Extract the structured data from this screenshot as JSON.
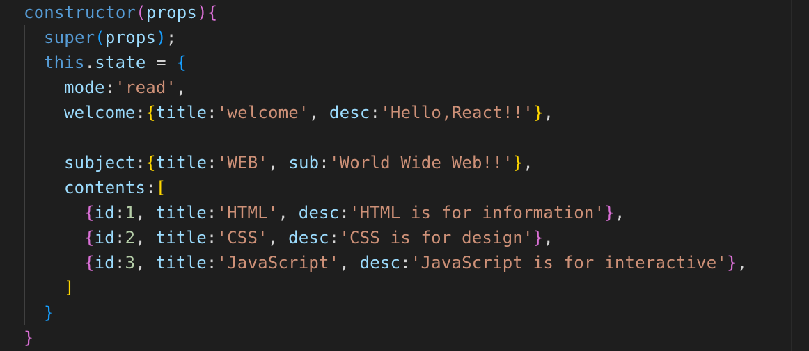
{
  "editor": {
    "colors": {
      "background": "#1e1e1e",
      "function": "#dcdcaa",
      "keyword": "#569cd6",
      "property": "#9cdcfe",
      "string": "#ce9178",
      "number": "#b5cea8",
      "punctuation": "#d4d4d4",
      "bracket_level_1": "#ffd700",
      "bracket_level_2": "#da70d6",
      "bracket_level_3": "#179fff"
    },
    "lines": [
      {
        "indent": 0,
        "tokens": [
          {
            "t": "constructor",
            "c": "key"
          },
          {
            "t": "(",
            "c": "b2"
          },
          {
            "t": "props",
            "c": "var"
          },
          {
            "t": ")",
            "c": "b2"
          },
          {
            "t": "{",
            "c": "b2"
          }
        ]
      },
      {
        "indent": 1,
        "tokens": [
          {
            "t": "super",
            "c": "key"
          },
          {
            "t": "(",
            "c": "b3"
          },
          {
            "t": "props",
            "c": "var"
          },
          {
            "t": ")",
            "c": "b3"
          },
          {
            "t": ";",
            "c": "punc"
          }
        ]
      },
      {
        "indent": 1,
        "tokens": [
          {
            "t": "this",
            "c": "key"
          },
          {
            "t": ".",
            "c": "punc"
          },
          {
            "t": "state",
            "c": "var"
          },
          {
            "t": " = ",
            "c": "punc"
          },
          {
            "t": "{",
            "c": "b3"
          }
        ]
      },
      {
        "indent": 2,
        "tokens": [
          {
            "t": "mode",
            "c": "var"
          },
          {
            "t": ":",
            "c": "punc"
          },
          {
            "t": "'read'",
            "c": "str"
          },
          {
            "t": ",",
            "c": "punc"
          }
        ]
      },
      {
        "indent": 2,
        "tokens": [
          {
            "t": "welcome",
            "c": "var"
          },
          {
            "t": ":",
            "c": "punc"
          },
          {
            "t": "{",
            "c": "b1"
          },
          {
            "t": "title",
            "c": "var"
          },
          {
            "t": ":",
            "c": "punc"
          },
          {
            "t": "'welcome'",
            "c": "str"
          },
          {
            "t": ", ",
            "c": "punc"
          },
          {
            "t": "desc",
            "c": "var"
          },
          {
            "t": ":",
            "c": "punc"
          },
          {
            "t": "'Hello,React!!'",
            "c": "str"
          },
          {
            "t": "}",
            "c": "b1"
          },
          {
            "t": ",",
            "c": "punc"
          }
        ]
      },
      {
        "indent": 2,
        "tokens": []
      },
      {
        "indent": 2,
        "tokens": [
          {
            "t": "subject",
            "c": "var"
          },
          {
            "t": ":",
            "c": "punc"
          },
          {
            "t": "{",
            "c": "b1"
          },
          {
            "t": "title",
            "c": "var"
          },
          {
            "t": ":",
            "c": "punc"
          },
          {
            "t": "'WEB'",
            "c": "str"
          },
          {
            "t": ", ",
            "c": "punc"
          },
          {
            "t": "sub",
            "c": "var"
          },
          {
            "t": ":",
            "c": "punc"
          },
          {
            "t": "'World Wide Web!!'",
            "c": "str"
          },
          {
            "t": "}",
            "c": "b1"
          },
          {
            "t": ",",
            "c": "punc"
          }
        ]
      },
      {
        "indent": 2,
        "tokens": [
          {
            "t": "contents",
            "c": "var"
          },
          {
            "t": ":",
            "c": "punc"
          },
          {
            "t": "[",
            "c": "b1"
          }
        ]
      },
      {
        "indent": 3,
        "tokens": [
          {
            "t": "{",
            "c": "b2"
          },
          {
            "t": "id",
            "c": "var"
          },
          {
            "t": ":",
            "c": "punc"
          },
          {
            "t": "1",
            "c": "num"
          },
          {
            "t": ", ",
            "c": "punc"
          },
          {
            "t": "title",
            "c": "var"
          },
          {
            "t": ":",
            "c": "punc"
          },
          {
            "t": "'HTML'",
            "c": "str"
          },
          {
            "t": ", ",
            "c": "punc"
          },
          {
            "t": "desc",
            "c": "var"
          },
          {
            "t": ":",
            "c": "punc"
          },
          {
            "t": "'HTML is for information'",
            "c": "str"
          },
          {
            "t": "}",
            "c": "b2"
          },
          {
            "t": ",",
            "c": "punc"
          }
        ]
      },
      {
        "indent": 3,
        "tokens": [
          {
            "t": "{",
            "c": "b2"
          },
          {
            "t": "id",
            "c": "var"
          },
          {
            "t": ":",
            "c": "punc"
          },
          {
            "t": "2",
            "c": "num"
          },
          {
            "t": ", ",
            "c": "punc"
          },
          {
            "t": "title",
            "c": "var"
          },
          {
            "t": ":",
            "c": "punc"
          },
          {
            "t": "'CSS'",
            "c": "str"
          },
          {
            "t": ", ",
            "c": "punc"
          },
          {
            "t": "desc",
            "c": "var"
          },
          {
            "t": ":",
            "c": "punc"
          },
          {
            "t": "'CSS is for design'",
            "c": "str"
          },
          {
            "t": "}",
            "c": "b2"
          },
          {
            "t": ",",
            "c": "punc"
          }
        ]
      },
      {
        "indent": 3,
        "tokens": [
          {
            "t": "{",
            "c": "b2"
          },
          {
            "t": "id",
            "c": "var"
          },
          {
            "t": ":",
            "c": "punc"
          },
          {
            "t": "3",
            "c": "num"
          },
          {
            "t": ", ",
            "c": "punc"
          },
          {
            "t": "title",
            "c": "var"
          },
          {
            "t": ":",
            "c": "punc"
          },
          {
            "t": "'JavaScript'",
            "c": "str"
          },
          {
            "t": ", ",
            "c": "punc"
          },
          {
            "t": "desc",
            "c": "var"
          },
          {
            "t": ":",
            "c": "punc"
          },
          {
            "t": "'JavaScript is for interactive'",
            "c": "str"
          },
          {
            "t": "}",
            "c": "b2"
          },
          {
            "t": ",",
            "c": "punc"
          }
        ]
      },
      {
        "indent": 2,
        "tokens": [
          {
            "t": "]",
            "c": "b1"
          }
        ]
      },
      {
        "indent": 1,
        "tokens": [
          {
            "t": "}",
            "c": "b3"
          }
        ]
      },
      {
        "indent": 0,
        "tokens": [
          {
            "t": "}",
            "c": "b2"
          }
        ]
      }
    ]
  }
}
